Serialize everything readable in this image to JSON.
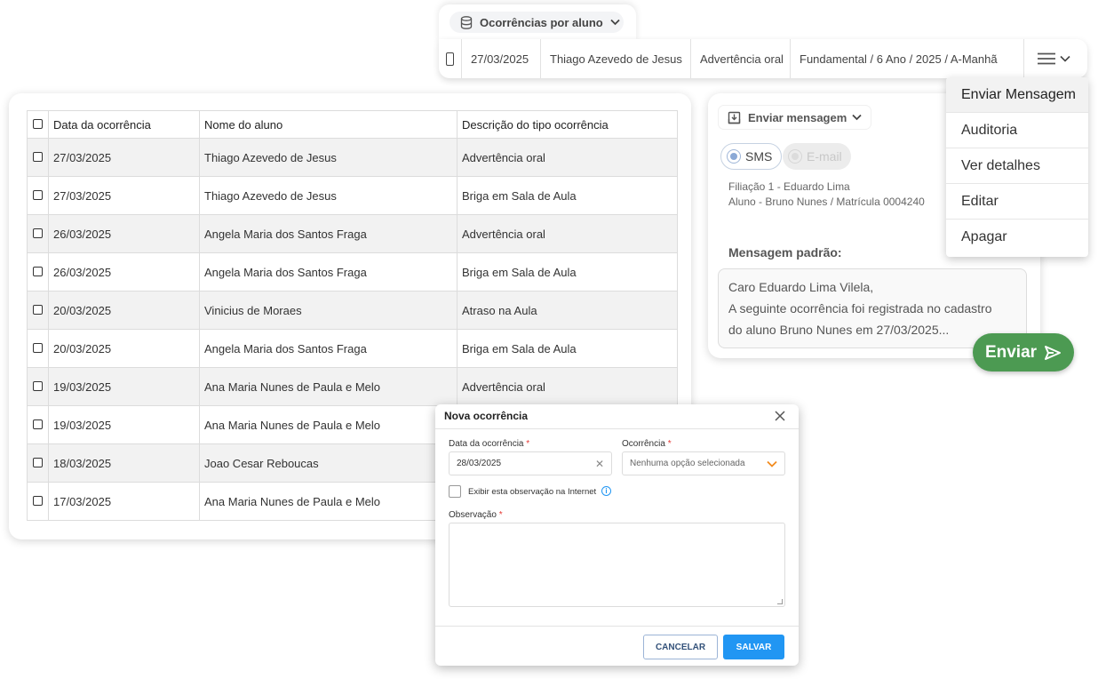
{
  "top_tab": {
    "label": "Ocorrências por aluno",
    "icon": "database-icon"
  },
  "summary_row": {
    "date": "27/03/2025",
    "student": "Thiago Azevedo de Jesus",
    "type": "Advertência oral",
    "class": "Fundamental / 6 Ano / 2025 / A-Manhã",
    "menu_icon": "hamburger-icon"
  },
  "table": {
    "headers": [
      "Data da ocorrência",
      "Nome do aluno",
      "Descrição do tipo ocorrência"
    ],
    "rows": [
      {
        "date": "27/03/2025",
        "name": "Thiago Azevedo de Jesus",
        "desc": "Advertência oral"
      },
      {
        "date": "27/03/2025",
        "name": "Thiago Azevedo de Jesus",
        "desc": "Briga em Sala de Aula"
      },
      {
        "date": "26/03/2025",
        "name": "Angela Maria dos Santos Fraga",
        "desc": "Advertência oral"
      },
      {
        "date": "26/03/2025",
        "name": "Angela Maria dos Santos Fraga",
        "desc": "Briga em Sala de Aula"
      },
      {
        "date": "20/03/2025",
        "name": "Vinicius de Moraes",
        "desc": "Atraso na Aula"
      },
      {
        "date": "20/03/2025",
        "name": "Angela Maria dos Santos Fraga",
        "desc": "Briga em Sala de Aula"
      },
      {
        "date": "19/03/2025",
        "name": "Ana Maria Nunes de Paula e Melo",
        "desc": "Advertência oral"
      },
      {
        "date": "19/03/2025",
        "name": "Ana Maria Nunes de Paula e Melo",
        "desc": ""
      },
      {
        "date": "18/03/2025",
        "name": "Joao Cesar Reboucas",
        "desc": ""
      },
      {
        "date": "17/03/2025",
        "name": "Ana Maria Nunes de Paula e Melo",
        "desc": ""
      }
    ]
  },
  "message": {
    "send_dropdown": "Enviar mensagem",
    "channels": {
      "sms": "SMS",
      "email": "E-mail",
      "selected": "SMS"
    },
    "filiacao": "Filiação 1 - Eduardo Lima",
    "aluno": "Aluno - Bruno Nunes / Matrícula 0004240",
    "template_title": "Mensagem padrão:",
    "template_lines": [
      "Caro Eduardo Lima Vilela,",
      "A seguinte ocorrência foi registrada no cadastro",
      "do aluno Bruno Nunes em 27/03/2025..."
    ],
    "send_button": "Enviar",
    "accent_color": "#4c9a52"
  },
  "action_menu": {
    "items": [
      "Enviar Mensagem",
      "Auditoria",
      "Ver detalhes",
      "Editar",
      "Apagar"
    ],
    "active": "Enviar Mensagem"
  },
  "modal": {
    "title": "Nova ocorrência",
    "date_label": "Data da ocorrência",
    "date_value": "28/03/2025",
    "type_label": "Ocorrência",
    "type_placeholder": "Nenhuma opção selecionada",
    "checkbox_label": "Exibir esta observação na Internet",
    "obs_label": "Observação",
    "required_mark": "*",
    "cancel": "CANCELAR",
    "save": "SALVAR",
    "primary_color": "#2196f3"
  }
}
